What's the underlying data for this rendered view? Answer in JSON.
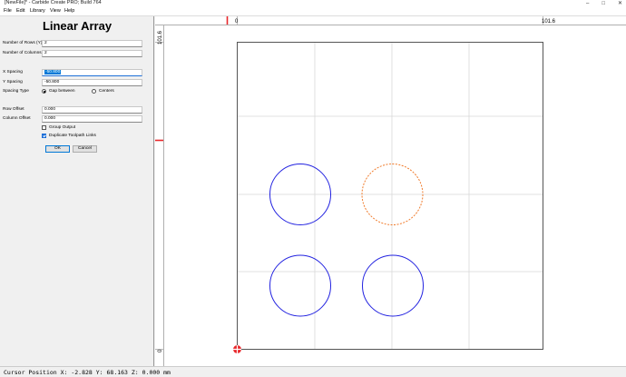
{
  "window": {
    "title": "[NewFile]* - Carbide Create PRO; Build 764",
    "controls": [
      "–",
      "□",
      "✕"
    ]
  },
  "menu": [
    "File",
    "Edit",
    "Library",
    "View",
    "Help"
  ],
  "dialog": {
    "title": "Linear Array",
    "rows_label": "Number of Rows (Y)",
    "rows_value": "2",
    "cols_label": "Number of Columns (X)",
    "cols_value": "2",
    "x_spacing_label": "X Spacing",
    "x_spacing_value": "-50.800",
    "y_spacing_label": "Y Spacing",
    "y_spacing_value": "-50.800",
    "spacing_type_label": "Spacing Type",
    "spacing_options": [
      "Gap between",
      "Centers"
    ],
    "spacing_selected": "Gap between",
    "row_offset_label": "Row Offset",
    "row_offset_value": "0.000",
    "col_offset_label": "Column Offset",
    "col_offset_value": "0.000",
    "group_output_label": "Group Output",
    "group_output_checked": false,
    "dup_toolpath_label": "Duplicate Toolpath Links",
    "dup_toolpath_checked": true,
    "ok_label": "OK",
    "cancel_label": "Cancel"
  },
  "canvas": {
    "ruler_top_labels": [
      "0",
      "101.6"
    ],
    "ruler_left_labels": [
      "101.6",
      "0"
    ],
    "colors": {
      "selected_shape": "#f07b2b",
      "shape": "#2222e0",
      "marker": "#e8262a",
      "grid": "#d8d8d8",
      "border": "#555555"
    },
    "shapes": [
      {
        "name": "circle-top-left",
        "style": "solid"
      },
      {
        "name": "circle-top-right",
        "style": "dashed-selected"
      },
      {
        "name": "circle-bottom-left",
        "style": "solid"
      },
      {
        "name": "circle-bottom-right",
        "style": "solid"
      }
    ]
  },
  "status": {
    "cursor_text": "Cursor Position X: -2.828 Y: 68.163 Z: 0.000 mm"
  }
}
